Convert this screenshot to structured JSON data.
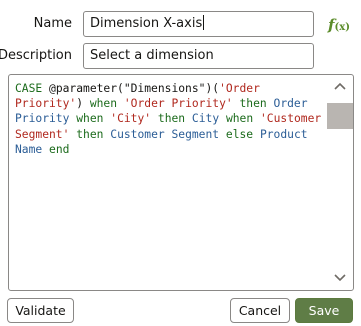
{
  "form": {
    "name_label": "Name",
    "name_value": "Dimension X-axis",
    "description_label": "Description",
    "description_value": "Select a dimension",
    "fx_label": "f",
    "fx_sub": "(x)"
  },
  "editor": {
    "tokens": [
      {
        "text": "CASE",
        "kind": "kw"
      },
      {
        "text": " @parameter(\"Dimensions\")(",
        "kind": "plain"
      },
      {
        "text": "'Order Priority'",
        "kind": "str"
      },
      {
        "text": ") ",
        "kind": "plain"
      },
      {
        "text": "when",
        "kind": "kw"
      },
      {
        "text": " ",
        "kind": "plain"
      },
      {
        "text": "'Order Priority'",
        "kind": "str"
      },
      {
        "text": " ",
        "kind": "plain"
      },
      {
        "text": "then",
        "kind": "kw"
      },
      {
        "text": " ",
        "kind": "plain"
      },
      {
        "text": "Order Priority",
        "kind": "id"
      },
      {
        "text": " ",
        "kind": "plain"
      },
      {
        "text": "when",
        "kind": "kw"
      },
      {
        "text": " ",
        "kind": "plain"
      },
      {
        "text": "'City'",
        "kind": "str"
      },
      {
        "text": " ",
        "kind": "plain"
      },
      {
        "text": "then",
        "kind": "kw"
      },
      {
        "text": " ",
        "kind": "plain"
      },
      {
        "text": "City",
        "kind": "id"
      },
      {
        "text": " ",
        "kind": "plain"
      },
      {
        "text": "when",
        "kind": "kw"
      },
      {
        "text": " ",
        "kind": "plain"
      },
      {
        "text": "'Customer Segment'",
        "kind": "str"
      },
      {
        "text": " ",
        "kind": "plain"
      },
      {
        "text": "then",
        "kind": "kw"
      },
      {
        "text": " ",
        "kind": "plain"
      },
      {
        "text": "Customer Segment",
        "kind": "id"
      },
      {
        "text": " ",
        "kind": "plain"
      },
      {
        "text": "else",
        "kind": "kw"
      },
      {
        "text": " ",
        "kind": "plain"
      },
      {
        "text": "Product Name",
        "kind": "id"
      },
      {
        "text": " ",
        "kind": "plain"
      },
      {
        "text": "end",
        "kind": "kw"
      }
    ]
  },
  "buttons": {
    "validate": "Validate",
    "cancel": "Cancel",
    "save": "Save"
  },
  "colors": {
    "keyword": "#1c6b1c",
    "string": "#b0281e",
    "identifier": "#2b5d96",
    "primary_button": "#5f7d46",
    "fx_icon": "#5b8c2a"
  },
  "icons": {
    "fx": "function-icon",
    "scroll_up": "chevron-up-icon",
    "scroll_down": "chevron-down-icon"
  }
}
